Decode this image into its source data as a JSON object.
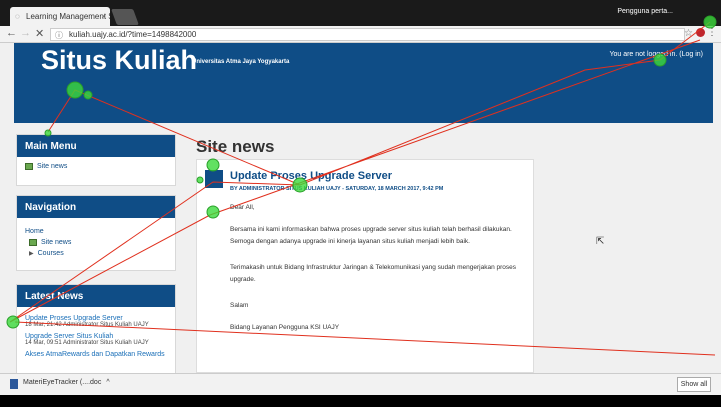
{
  "browser": {
    "tab_title": "Learning Management S",
    "tab_close": "×",
    "profile_label": "Pengguna perta...",
    "url": "kuliah.uajy.ac.id/?time=1498842000",
    "star": "☆",
    "menu": "⋮"
  },
  "nav": {
    "back": "←",
    "forward": "→",
    "reload": "✕",
    "info": "ⓘ"
  },
  "header": {
    "title": "Situs Kuliah",
    "subtitle": "Universitas Atma Jaya Yogyakarta",
    "login_text": "You are not logged in. (Log in)"
  },
  "main_menu": {
    "title": "Main Menu",
    "items": [
      "Site news"
    ]
  },
  "navigation": {
    "title": "Navigation",
    "home": "Home",
    "site_news": "Site news",
    "courses": "Courses",
    "bullet": "▶"
  },
  "latest_news": {
    "title": "Latest News",
    "items": [
      {
        "title": "Update Proses Upgrade Server",
        "meta": "18 Mar, 21:42 Administrator Situs Kuliah UAJY"
      },
      {
        "title": "Upgrade Server Situs Kuliah",
        "meta": "14 Mar, 09:51 Administrator Situs Kuliah UAJY"
      },
      {
        "title": "Akses AtmaRewards dan Dapatkan Rewards",
        "meta": ""
      }
    ]
  },
  "site_news": {
    "heading": "Site news",
    "post": {
      "title": "Update Proses Upgrade Server",
      "meta": "BY ADMINISTRATOR SITUS KULIAH UAJY - SATURDAY, 18 MARCH 2017, 9:42 PM",
      "greeting": "Dear All,",
      "para1": "Bersama ini kami informasikan bahwa proses upgrade server situs kuliah telah berhasil dilakukan. Semoga dengan adanya upgrade ini kinerja layanan situs kuliah menjadi lebih baik.",
      "para2": "Terimakasih untuk Bidang Infrastruktur Jaringan & Telekomunikasi yang sudah mengerjakan proses upgrade.",
      "closing": "Salam",
      "signature": "Bidang Layanan Pengguna KSI UAJY"
    }
  },
  "downloads": {
    "file": "MateriEyeTracker (....doc",
    "caret": "^",
    "show_all": "Show all"
  },
  "colors": {
    "header": "#0f4d86",
    "gaze": "#3bd93b",
    "scan_path": "#e0301e"
  }
}
